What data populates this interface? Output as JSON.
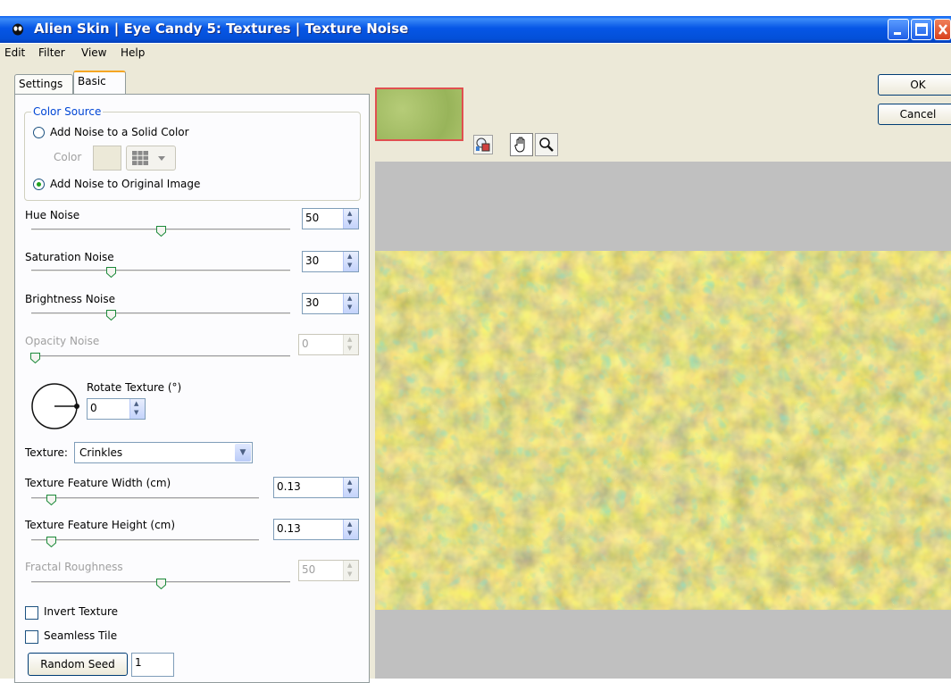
{
  "window": {
    "title": "Alien Skin | Eye Candy 5: Textures | Texture Noise"
  },
  "menu": [
    "Edit",
    "Filter",
    "View",
    "Help"
  ],
  "tabs": [
    {
      "label": "Settings",
      "active": false
    },
    {
      "label": "Basic",
      "active": true
    }
  ],
  "color_source": {
    "title": "Color Source",
    "option_solid": "Add Noise to a Solid Color",
    "color_label": "Color",
    "option_original": "Add Noise to Original Image",
    "selected": "original"
  },
  "sliders": {
    "hue": {
      "label": "Hue Noise",
      "value": "50",
      "level": 0.5,
      "enabled": true
    },
    "saturation": {
      "label": "Saturation Noise",
      "value": "30",
      "level": 0.3,
      "enabled": true
    },
    "brightness": {
      "label": "Brightness Noise",
      "value": "30",
      "level": 0.3,
      "enabled": true
    },
    "opacity": {
      "label": "Opacity Noise",
      "value": "0",
      "level": 0.0,
      "enabled": false
    },
    "feature_width": {
      "label": "Texture Feature Width (cm)",
      "value": "0.13",
      "level": 0.08,
      "enabled": true
    },
    "feature_height": {
      "label": "Texture Feature Height (cm)",
      "value": "0.13",
      "level": 0.08,
      "enabled": true
    },
    "fractal": {
      "label": "Fractal Roughness",
      "value": "50",
      "level": 0.5,
      "enabled": false
    }
  },
  "rotate": {
    "label": "Rotate Texture (°)",
    "value": "0"
  },
  "texture": {
    "label": "Texture:",
    "value": "Crinkles"
  },
  "checkboxes": {
    "invert": {
      "label": "Invert Texture",
      "checked": false
    },
    "seamless": {
      "label": "Seamless Tile",
      "checked": false
    }
  },
  "random_seed": {
    "label": "Random Seed",
    "value": "1"
  },
  "buttons": {
    "ok": "OK",
    "cancel": "Cancel"
  },
  "colors": {
    "title_bar": "#0656e6",
    "panel": "#ece9d8",
    "preview_bg": "#c0c0c0",
    "texture_base": "#c8b86a",
    "preview_border": "#e05050"
  }
}
